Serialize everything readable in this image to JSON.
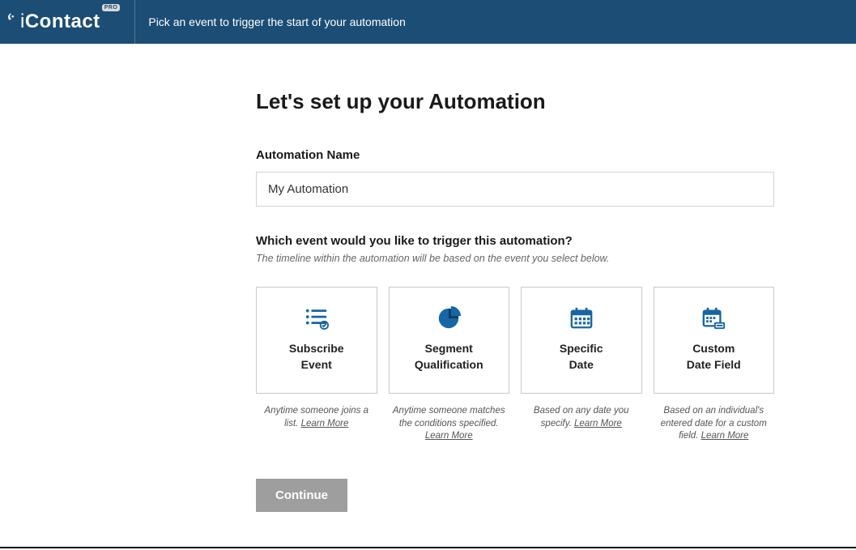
{
  "colors": {
    "accent": "#1666a5",
    "header_bg": "#1b4d75"
  },
  "logo": {
    "prefix": "i",
    "name": "Contact",
    "badge": "PRO"
  },
  "header": {
    "instruction": "Pick an event to trigger the start of your automation"
  },
  "page": {
    "title": "Let's set up your Automation",
    "name_label": "Automation Name",
    "name_value": "My Automation",
    "trigger_question": "Which event would you like to trigger this automation?",
    "trigger_subtext": "The timeline within the automation will be based on the event you select below.",
    "continue": "Continue"
  },
  "learn_more": "Learn More",
  "cards": [
    {
      "id": "subscribe",
      "title_line1": "Subscribe",
      "title_line2": "Event",
      "desc": "Anytime someone joins a list."
    },
    {
      "id": "segment",
      "title_line1": "Segment",
      "title_line2": "Qualification",
      "desc": "Anytime someone matches the conditions specified."
    },
    {
      "id": "specific-date",
      "title_line1": "Specific",
      "title_line2": "Date",
      "desc": "Based on any date you specify."
    },
    {
      "id": "custom-date",
      "title_line1": "Custom",
      "title_line2": "Date Field",
      "desc": "Based on an individual's entered date for a custom field."
    }
  ]
}
